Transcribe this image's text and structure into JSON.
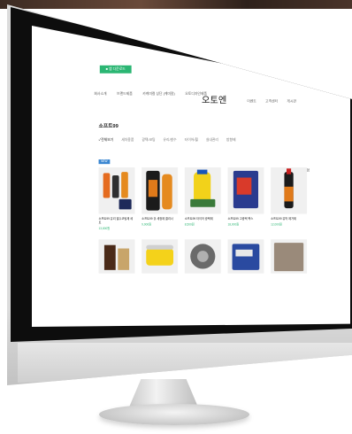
{
  "site": {
    "logo": "오토엔"
  },
  "header": {
    "nav_left": [
      "회사소개",
      "브랜드제품",
      "카케미컬 상단 (케미칼)",
      "오토디자인제품"
    ],
    "nav_right": [
      "이벤트",
      "고객센터",
      "게시판"
    ],
    "utility": [
      "로그인",
      "회원가입",
      "장바구니"
    ]
  },
  "section": {
    "title": "소프트99",
    "filters": [
      "✓전체보기",
      "세차용품",
      "광택/코팅",
      "유리/발수",
      "타이어/휠",
      "실내관리",
      "방향제"
    ]
  },
  "toolbar": {
    "sort_label": "정렬",
    "view_label": "목록형"
  },
  "badge": {
    "new": "NEW"
  },
  "products_row1": [
    {
      "name": "소프트99 유리 발수코팅제 세트",
      "price": "13,800원"
    },
    {
      "name": "소프트99 휠 세정제 클리너",
      "price": "9,900원"
    },
    {
      "name": "소프트99 타이어 광택제",
      "price": "8,500원"
    },
    {
      "name": "소프트99 고광택 왁스",
      "price": "18,000원"
    },
    {
      "name": "소프트99 유막 제거제",
      "price": "12,000원"
    }
  ],
  "products_row2": [
    {
      "name": "소프트99 세차 샴푸"
    },
    {
      "name": "소프트99 컴파운드"
    },
    {
      "name": "소프트99 휠 코팅"
    },
    {
      "name": "소프트99 도장 보호"
    },
    {
      "name": "소프트99 실내 클리너"
    }
  ],
  "colors": {
    "accent_green": "#2bb673",
    "badge_blue": "#3a86d1"
  }
}
